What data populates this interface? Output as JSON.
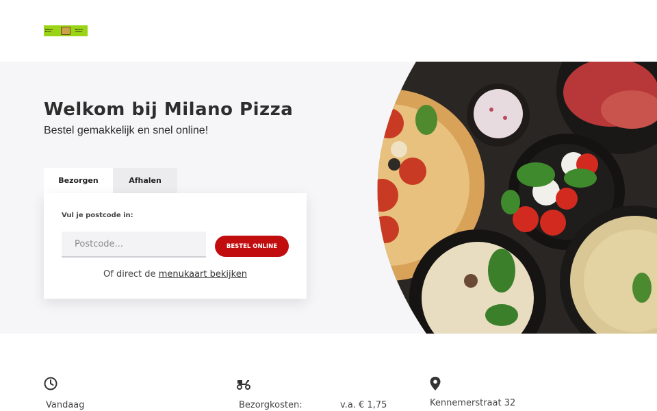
{
  "header": {
    "logo": {
      "text_left": "Milano Pizza",
      "text_right": "Bestel online",
      "color": "#9bd416"
    }
  },
  "hero": {
    "title": "Welkom bij Milano Pizza",
    "subtitle": "Bestel gemakkelijk en snel online!",
    "tabs": [
      {
        "label": "Bezorgen",
        "active": true
      },
      {
        "label": "Afhalen",
        "active": false
      }
    ],
    "form": {
      "label": "Vul je postcode in:",
      "postcode_placeholder": "Postcode...",
      "postcode_value": "",
      "order_button": "BESTEL ONLINE",
      "menu_prefix": "Of direct de",
      "menu_link": "menukaart bekijken"
    },
    "accent_color": "#c10d0d",
    "background_color": "#f6f6f8"
  },
  "info": {
    "hours": {
      "icon": "clock-icon",
      "text": "Vandaag"
    },
    "delivery": {
      "icon": "scooter-icon",
      "label": "Bezorgkosten:",
      "value": "v.a. € 1,75"
    },
    "address": {
      "icon": "location-pin-icon",
      "text": "Kennemerstraat 32"
    }
  }
}
